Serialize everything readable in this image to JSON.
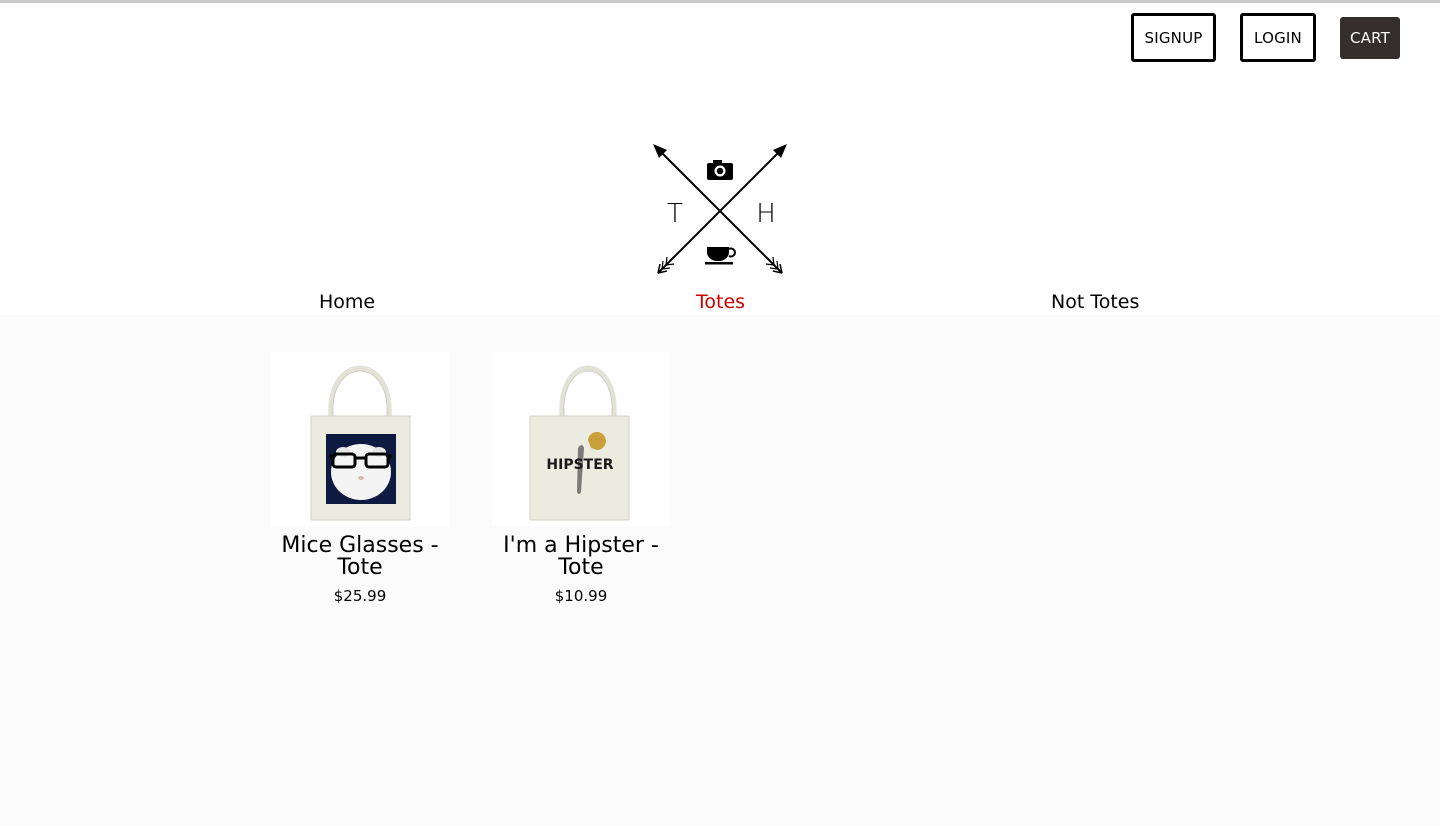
{
  "header": {
    "signup_label": "SIGNUP",
    "login_label": "LOGIN",
    "cart_label": "CART",
    "logo": {
      "letter_left": "T",
      "letter_right": "H",
      "icons": [
        "camera-icon",
        "coffee-cup-icon",
        "arrow-icon"
      ]
    }
  },
  "nav": {
    "items": [
      {
        "label": "Home",
        "active": false
      },
      {
        "label": "Totes",
        "active": true
      },
      {
        "label": "Not Totes",
        "active": false
      }
    ],
    "active_color": "#cc0000"
  },
  "products": [
    {
      "name": "Mice Glasses - Tote",
      "price": "$25.99",
      "image": "tote-guinea-pig-glasses"
    },
    {
      "name": "I'm a Hipster - Tote",
      "price": "$10.99",
      "image": "tote-hipster-text",
      "image_text": "HIPSTER"
    }
  ],
  "colors": {
    "cart_bg": "#342e2d",
    "page_bg": "#fbfbfb",
    "tote": "#ecebe0",
    "print_navy": "#0e1a3f"
  }
}
